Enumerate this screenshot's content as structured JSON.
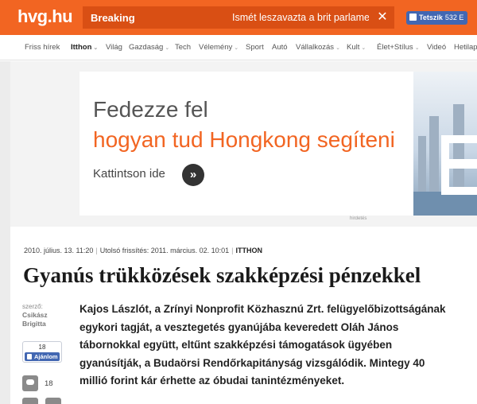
{
  "header": {
    "logo": "hvg.hu",
    "breaking_label": "Breaking",
    "breaking_text": "Ismét leszavazta a brit parlament a",
    "close_glyph": "✕",
    "fb_like_label": "Tetszik",
    "fb_like_count": "532 E"
  },
  "nav": {
    "items": [
      {
        "label": "Friss hírek",
        "dropdown": false
      },
      {
        "label": "Itthon",
        "dropdown": true,
        "active": true
      },
      {
        "label": "Világ",
        "dropdown": false
      },
      {
        "label": "Gazdaság",
        "dropdown": true
      },
      {
        "label": "Tech",
        "dropdown": false
      },
      {
        "label": "Vélemény",
        "dropdown": true
      },
      {
        "label": "Sport",
        "dropdown": false
      },
      {
        "label": "Autó",
        "dropdown": false
      },
      {
        "label": "Vállalkozás",
        "dropdown": true
      },
      {
        "label": "Kult",
        "dropdown": true
      },
      {
        "label": "Élet+Stílus",
        "dropdown": true
      },
      {
        "label": "Videó",
        "dropdown": false
      },
      {
        "label": "Hetilap",
        "dropdown": false
      }
    ]
  },
  "ad": {
    "line1": "Fedezze fel",
    "line2": "hogyan tud Hongkong segíteni",
    "cta": "Kattintson ide",
    "arrow_glyph": "»",
    "label": "hirdetés"
  },
  "article": {
    "published": "2010. július. 13. 11:20",
    "updated": "Utolsó frissítés: 2011. március. 02. 10:01",
    "rovat": "ITTHON",
    "title": "Gyanús trükközések szakképzési pénzekkel",
    "author_label": "szerző:",
    "author_name": "Csikász Brigitta",
    "fb_share_count": "18",
    "fb_share_label": "Ajánlom",
    "comment_count": "18",
    "lead": "Kajos Lászlót, a Zrínyi Nonprofit Közhasznú Zrt. felügyelőbizottságának egykori tagját, a vesztegetés gyanújába keveredett Oláh János tábornokkal együtt, eltűnt szakképzési támogatások ügyében gyanúsítják, a Budaörsi Rendőrkapitányság vizsgálódik. Mintegy 40 millió forint kár érhette az óbudai tanintézményeket."
  },
  "colors": {
    "brand_orange": "#f26522",
    "breaking_bg": "#d94f14",
    "facebook_blue": "#4267b2"
  }
}
